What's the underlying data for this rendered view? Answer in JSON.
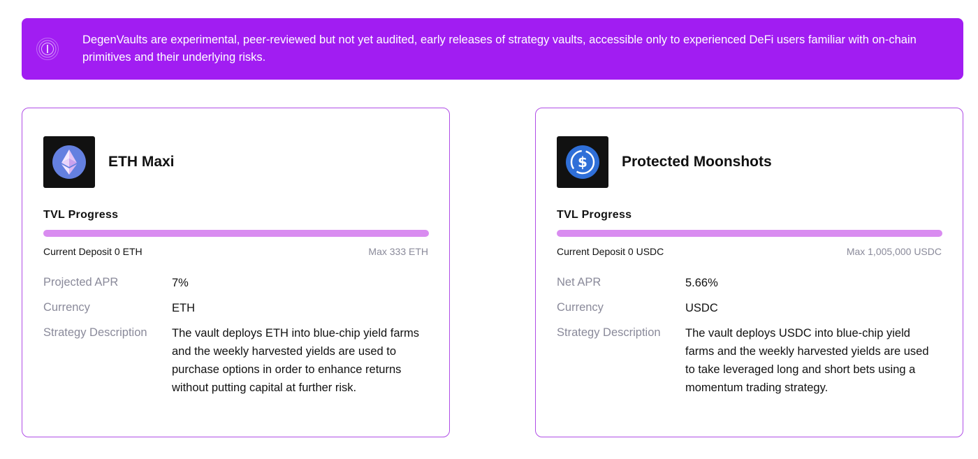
{
  "banner": {
    "text": "DegenVaults are experimental, peer-reviewed but not yet audited, early releases of strategy vaults, accessible only to experienced DeFi users familiar with on-chain primitives and their underlying risks.",
    "icon": "info-icon"
  },
  "vaults": [
    {
      "name": "ETH Maxi",
      "icon": "ethereum-icon",
      "tvl_label": "TVL Progress",
      "progress_fraction": 0,
      "current_deposit": "Current Deposit 0 ETH",
      "max": "Max 333 ETH",
      "apr_label": "Projected APR",
      "apr_value": "7%",
      "currency_label": "Currency",
      "currency_value": "ETH",
      "strategy_label": "Strategy Description",
      "strategy_value": "The vault deploys ETH into blue-chip yield farms and the weekly harvested yields are used to purchase options in order to enhance returns without putting capital at further risk."
    },
    {
      "name": "Protected Moonshots",
      "icon": "usdc-icon",
      "tvl_label": "TVL Progress",
      "progress_fraction": 0,
      "current_deposit": "Current Deposit 0 USDC",
      "max": "Max 1,005,000 USDC",
      "apr_label": "Net APR",
      "apr_value": "5.66%",
      "currency_label": "Currency",
      "currency_value": "USDC",
      "strategy_label": "Strategy Description",
      "strategy_value": "The vault deploys USDC into blue-chip yield farms and the weekly harvested yields are used to take leveraged long and short bets using a momentum trading strategy."
    }
  ],
  "colors": {
    "accent": "#a11df2",
    "progress_track": "#d98cf0",
    "card_border": "#b04ee6",
    "muted_text": "#8a8a9a"
  }
}
